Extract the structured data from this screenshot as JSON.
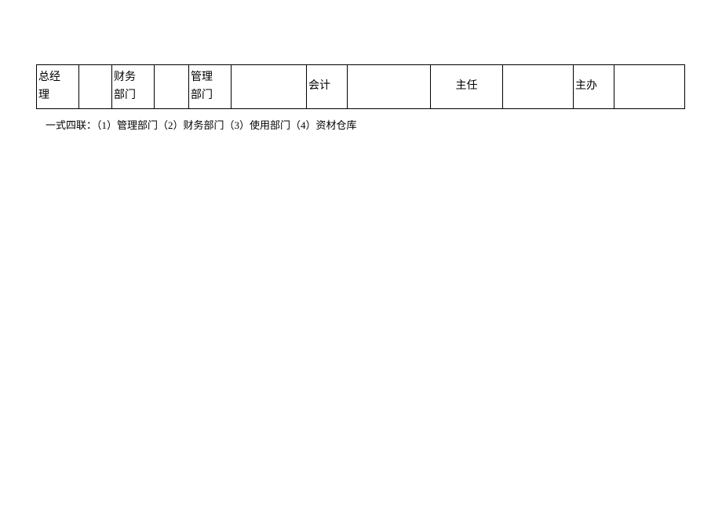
{
  "signatures": {
    "general_manager": {
      "label": "总经\n理",
      "value": ""
    },
    "finance_dept": {
      "label": "财务\n部门",
      "value": ""
    },
    "management_dept": {
      "label": "管理\n部门",
      "value": ""
    },
    "accountant": {
      "label": "会计",
      "value": ""
    },
    "director": {
      "label": "主任",
      "value": ""
    },
    "handler": {
      "label": "主办",
      "value": ""
    }
  },
  "footnote": "一式四联：（1）管理部门（2）财务部门（3）使用部门（4）资材仓库"
}
